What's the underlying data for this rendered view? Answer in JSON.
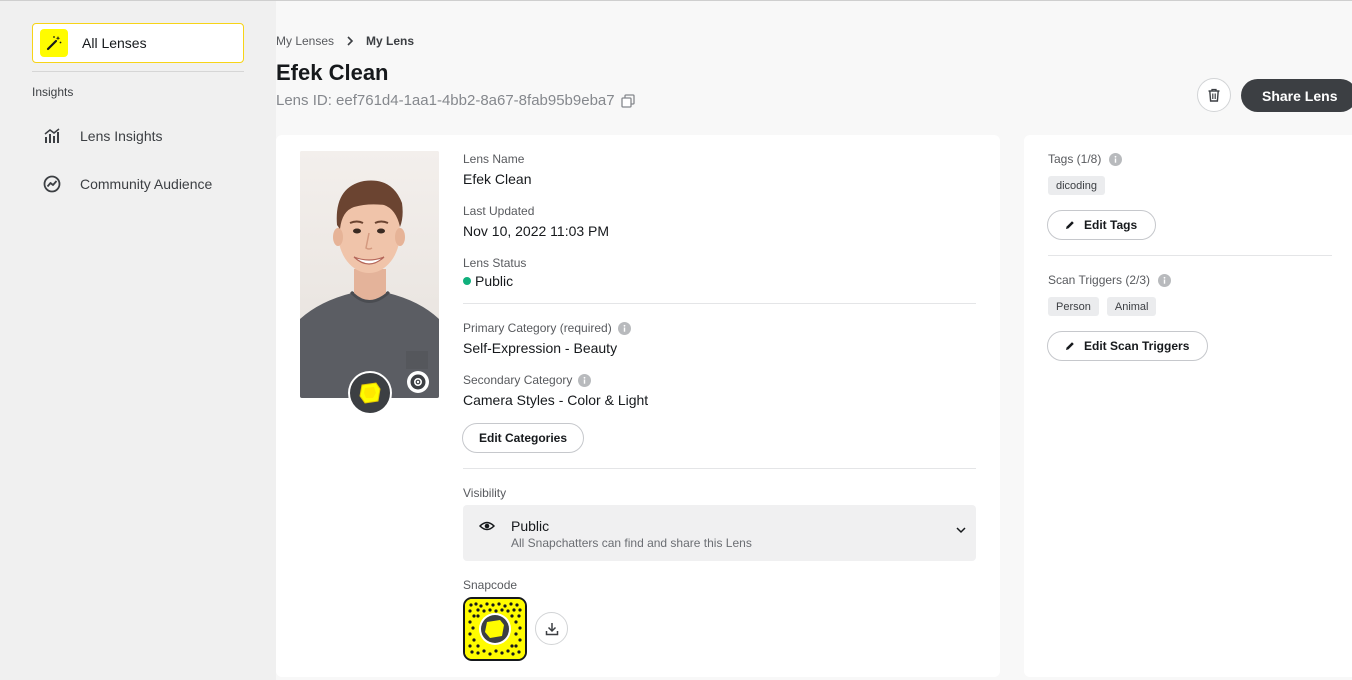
{
  "sidebar": {
    "all_lenses": {
      "label": "All Lenses",
      "icon": "magic-wand-icon"
    },
    "section_label": "Insights",
    "items": [
      {
        "label": "Lens Insights",
        "icon": "bar-chart-icon"
      },
      {
        "label": "Community Audience",
        "icon": "trend-circle-icon"
      }
    ]
  },
  "breadcrumb": {
    "parent": "My Lenses",
    "current": "My Lens"
  },
  "header": {
    "title": "Efek Clean",
    "lens_id": "Lens ID: eef761d4-1aa1-4bb2-8a67-8fab95b9eba7",
    "share_label": "Share Lens"
  },
  "details": {
    "lens_name_label": "Lens Name",
    "lens_name": "Efek Clean",
    "last_updated_label": "Last Updated",
    "last_updated": "Nov 10, 2022 11:03 PM",
    "status_label": "Lens Status",
    "status": "Public",
    "primary_category_label": "Primary Category (required)",
    "primary_category": "Self-Expression - Beauty",
    "secondary_category_label": "Secondary Category",
    "secondary_category": "Camera Styles - Color & Light",
    "edit_categories_label": "Edit Categories",
    "visibility_label": "Visibility",
    "visibility": {
      "selected": "Public",
      "description": "All Snapchatters can find and share this Lens"
    },
    "snapcode_label": "Snapcode"
  },
  "tags": {
    "label": "Tags (1/8)",
    "items": [
      "dicoding"
    ],
    "edit_label": "Edit Tags"
  },
  "scan_triggers": {
    "label": "Scan Triggers (2/3)",
    "items": [
      "Person",
      "Animal"
    ],
    "edit_label": "Edit Scan Triggers"
  },
  "colors": {
    "accent_yellow": "#fffc00",
    "status_green": "#10b07c",
    "dark_button": "#3c3f43"
  }
}
